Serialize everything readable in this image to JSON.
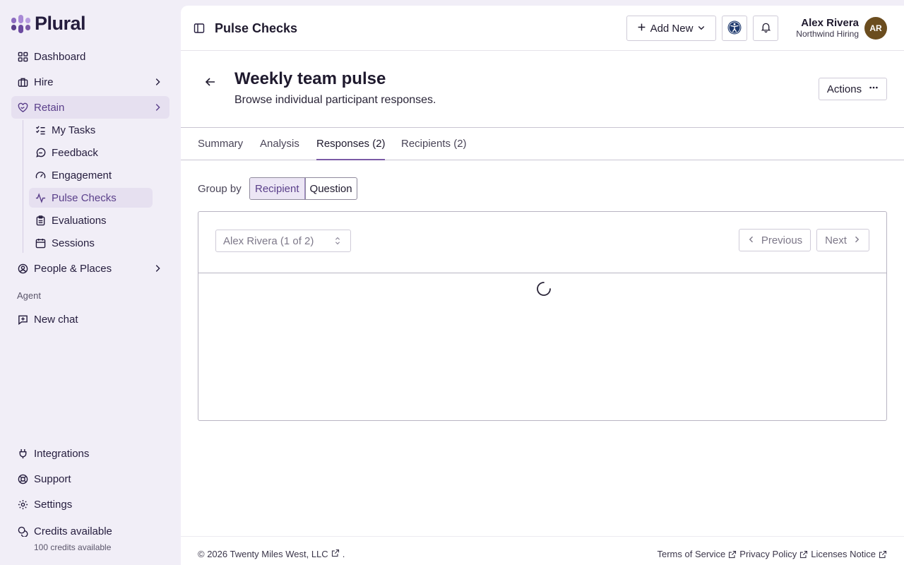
{
  "app": {
    "logo_text": "Plural"
  },
  "sidebar": {
    "items": [
      {
        "label": "Dashboard",
        "icon": "dashboard-icon"
      },
      {
        "label": "Hire",
        "icon": "briefcase-icon"
      },
      {
        "label": "Retain",
        "icon": "heart-handshake-icon"
      },
      {
        "label": "People & Places",
        "icon": "user-circle-icon"
      }
    ],
    "retain_sub": [
      {
        "label": "My Tasks",
        "icon": "list-checks-icon"
      },
      {
        "label": "Feedback",
        "icon": "message-icon"
      },
      {
        "label": "Engagement",
        "icon": "gauge-icon"
      },
      {
        "label": "Pulse Checks",
        "icon": "activity-icon"
      },
      {
        "label": "Evaluations",
        "icon": "clipboard-icon"
      },
      {
        "label": "Sessions",
        "icon": "calendar-icon"
      }
    ],
    "agent_section": "Agent",
    "new_chat": "New chat",
    "bottom": {
      "integrations": "Integrations",
      "support": "Support",
      "settings": "Settings",
      "credits": "Credits available",
      "credits_sub": "100 credits available"
    }
  },
  "topbar": {
    "title": "Pulse Checks",
    "add_new": "Add New",
    "user_name": "Alex Rivera",
    "user_org": "Northwind Hiring",
    "avatar_initials": "AR"
  },
  "header": {
    "title": "Weekly team pulse",
    "subtitle": "Browse individual participant responses.",
    "actions": "Actions"
  },
  "tabs": [
    {
      "label": "Summary"
    },
    {
      "label": "Analysis"
    },
    {
      "label": "Responses (2)",
      "active": true
    },
    {
      "label": "Recipients (2)"
    }
  ],
  "group_by": {
    "label": "Group by",
    "options": [
      "Recipient",
      "Question"
    ],
    "selected": "Recipient"
  },
  "responses": {
    "recipient_select": "Alex Rivera (1 of 2)",
    "previous": "Previous",
    "next": "Next"
  },
  "footer": {
    "copyright": "© 2026 Twenty Miles West, LLC",
    "links": [
      "Terms of Service",
      "Privacy Policy",
      "Licenses Notice"
    ]
  },
  "colors": {
    "accent": "#7b5aa6",
    "sidebar_bg": "#f1eef7",
    "active_bg": "#e6e0f0",
    "avatar_bg": "#6b4d1f"
  }
}
